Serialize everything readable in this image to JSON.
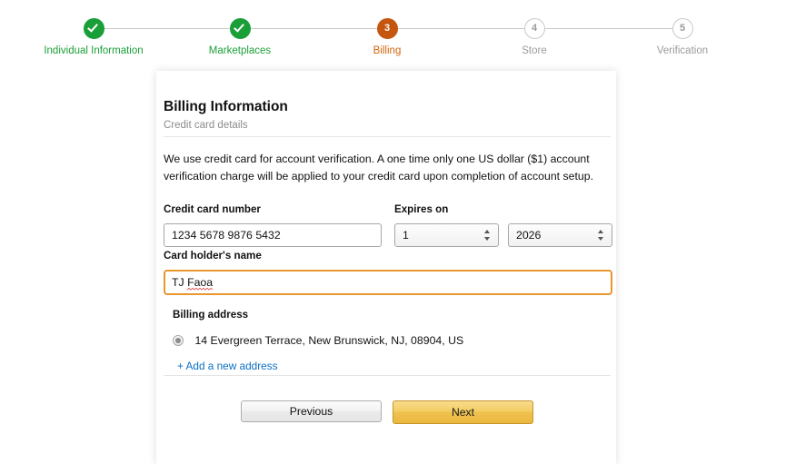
{
  "stepper": {
    "steps": [
      {
        "label": "Individual Information",
        "number": "1",
        "state": "done",
        "marker": "check-icon"
      },
      {
        "label": "Marketplaces",
        "number": "2",
        "state": "done",
        "marker": "check-icon"
      },
      {
        "label": "Billing",
        "number": "3",
        "state": "current",
        "marker": "3"
      },
      {
        "label": "Store",
        "number": "4",
        "state": "upcoming",
        "marker": "4"
      },
      {
        "label": "Verification",
        "number": "5",
        "state": "upcoming",
        "marker": "5"
      }
    ],
    "colors": {
      "done": "#1a9f38",
      "current": "#c4560f",
      "current_label": "#d2650f",
      "upcoming": "#9b9b9b",
      "connector": "#c9c9c9"
    }
  },
  "card": {
    "title": "Billing Information",
    "subtitle": "Credit card details",
    "intro": "We use credit card for account verification. A one time only one US dollar ($1) account verification charge will be applied to your credit card upon completion of account setup.",
    "fields": {
      "card_number_label": "Credit card number",
      "card_number_value": "1234 5678 9876 5432",
      "card_number_placeholder": "Credit card number",
      "expires_label": "Expires on",
      "expires_month_value": "1",
      "expires_year_value": "2026",
      "holder_label": "Card holder's name",
      "holder_value_ok": "TJ ",
      "holder_value_misspelled": "Faoa",
      "holder_placeholder": "Card holder's name"
    },
    "billing_address": {
      "label": "Billing address",
      "selected_address": "14 Evergreen Terrace, New Brunswick, NJ, 08904, US",
      "add_link": "+ Add a new address",
      "link_color": "#0b6fc4"
    },
    "buttons": {
      "previous": "Previous",
      "next": "Next",
      "next_accent": "#eec24f"
    }
  }
}
